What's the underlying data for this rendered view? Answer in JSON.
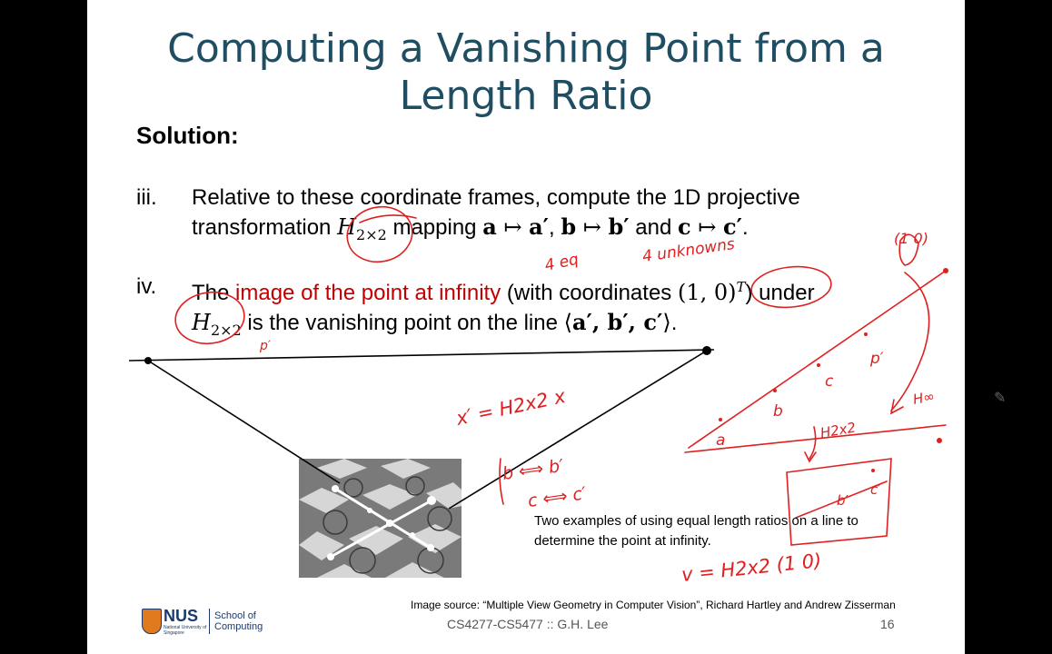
{
  "title_lines": [
    "Computing a Vanishing Point from a",
    "Length Ratio"
  ],
  "solution_label": "Solution:",
  "items": [
    {
      "num": "iii.",
      "line1": "Relative to these coordinate frames, compute the 1D projective",
      "line2_pre": "transformation ",
      "H": "H",
      "H_sub": "2×2",
      "line2_mid": " mapping ",
      "a": "a",
      "map": " ↦ ",
      "a_prime": "a′",
      "comma1": ", ",
      "b": "b",
      "b_prime": "b′",
      "and": " and ",
      "c": "c",
      "c_prime": "c′",
      "end": "."
    },
    {
      "num": "iv.",
      "pre": "The ",
      "highlight": "image of the point at infinity",
      "mid": " (with coordinates ",
      "coords": "(1, 0)",
      "sup": "T",
      "post": ") under",
      "H": "H",
      "H_sub": "2×2",
      "line2": " is the vanishing point on the line ⟨",
      "pts": "a′, b′, c′",
      "close": "⟩."
    }
  ],
  "caption_lines": [
    "Two examples of using equal length ratios on a line to",
    "determine the point at infinity."
  ],
  "image_source": "Image source: “Multiple View Geometry in Computer Vision”, Richard Hartley and Andrew Zisserman",
  "footer": "CS4277-CS5477 :: G.H. Lee",
  "page_number": "16",
  "logo": {
    "name": "NUS",
    "sub": "National University of Singapore",
    "school_line1": "School of",
    "school_line2": "Computing"
  },
  "annotations": {
    "p_prime_1": "p′",
    "four_eq": "4 eq",
    "four_unknown": "4 unknowns",
    "one_zero_top": "(1 0)",
    "x_eq": "x′ = H2x2 x",
    "b_map": "b ⟺ b′",
    "c_map": "c ⟺ c′",
    "v_eq": "v = H2x2 (1 0)",
    "label_a": "a",
    "label_b": "b",
    "label_c": "c",
    "label_pp": "p′",
    "label_H": "H2x2",
    "label_Hinf": "H∞",
    "label_bp": "b′",
    "label_cp": "c′"
  },
  "colors": {
    "title": "#1f4e63",
    "highlight": "#c00000",
    "ink": "#e02020"
  }
}
